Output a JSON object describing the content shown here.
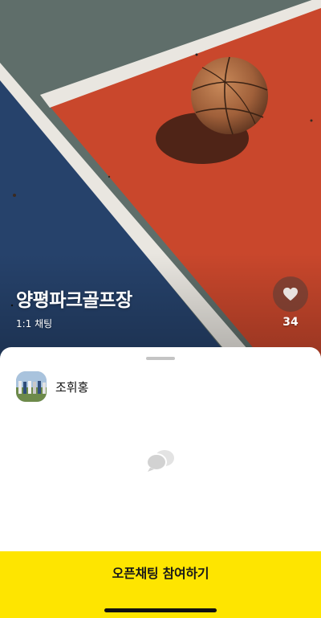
{
  "room": {
    "title": "양평파크골프장",
    "type_label": "1:1 채팅",
    "like_count": "34"
  },
  "host": {
    "name": "조휘홍"
  },
  "actions": {
    "join_label": "오픈채팅 참여하기"
  },
  "icons": {
    "like": "heart-icon",
    "empty_state": "chat-bubbles-icon"
  },
  "colors": {
    "join_bar": "#fee500",
    "court_red": "#c9472c",
    "court_blue": "#26426b",
    "court_gray": "#5f6e6a"
  }
}
